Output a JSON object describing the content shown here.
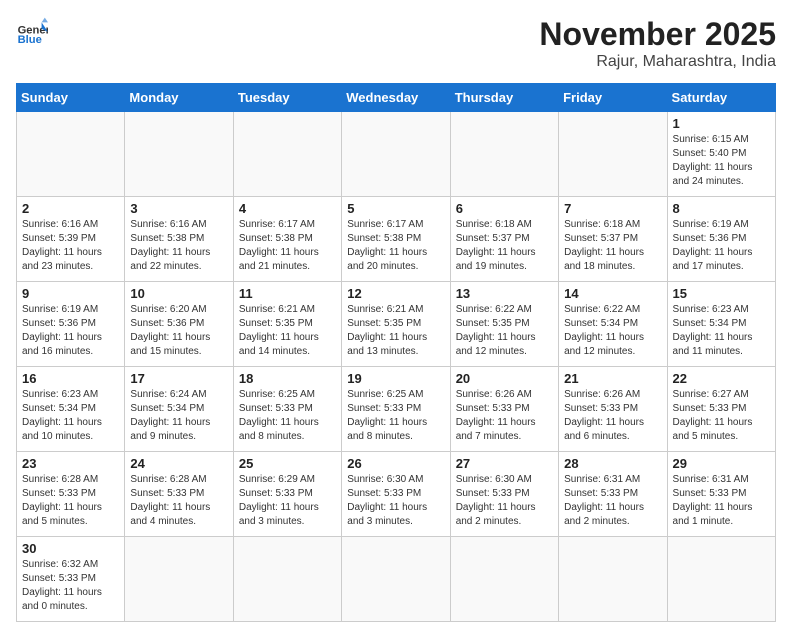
{
  "header": {
    "logo_general": "General",
    "logo_blue": "Blue",
    "month_title": "November 2025",
    "location": "Rajur, Maharashtra, India"
  },
  "weekdays": [
    "Sunday",
    "Monday",
    "Tuesday",
    "Wednesday",
    "Thursday",
    "Friday",
    "Saturday"
  ],
  "days": {
    "1": {
      "sunrise": "6:15 AM",
      "sunset": "5:40 PM",
      "daylight": "11 hours and 24 minutes."
    },
    "2": {
      "sunrise": "6:16 AM",
      "sunset": "5:39 PM",
      "daylight": "11 hours and 23 minutes."
    },
    "3": {
      "sunrise": "6:16 AM",
      "sunset": "5:38 PM",
      "daylight": "11 hours and 22 minutes."
    },
    "4": {
      "sunrise": "6:17 AM",
      "sunset": "5:38 PM",
      "daylight": "11 hours and 21 minutes."
    },
    "5": {
      "sunrise": "6:17 AM",
      "sunset": "5:38 PM",
      "daylight": "11 hours and 20 minutes."
    },
    "6": {
      "sunrise": "6:18 AM",
      "sunset": "5:37 PM",
      "daylight": "11 hours and 19 minutes."
    },
    "7": {
      "sunrise": "6:18 AM",
      "sunset": "5:37 PM",
      "daylight": "11 hours and 18 minutes."
    },
    "8": {
      "sunrise": "6:19 AM",
      "sunset": "5:36 PM",
      "daylight": "11 hours and 17 minutes."
    },
    "9": {
      "sunrise": "6:19 AM",
      "sunset": "5:36 PM",
      "daylight": "11 hours and 16 minutes."
    },
    "10": {
      "sunrise": "6:20 AM",
      "sunset": "5:36 PM",
      "daylight": "11 hours and 15 minutes."
    },
    "11": {
      "sunrise": "6:21 AM",
      "sunset": "5:35 PM",
      "daylight": "11 hours and 14 minutes."
    },
    "12": {
      "sunrise": "6:21 AM",
      "sunset": "5:35 PM",
      "daylight": "11 hours and 13 minutes."
    },
    "13": {
      "sunrise": "6:22 AM",
      "sunset": "5:35 PM",
      "daylight": "11 hours and 12 minutes."
    },
    "14": {
      "sunrise": "6:22 AM",
      "sunset": "5:34 PM",
      "daylight": "11 hours and 12 minutes."
    },
    "15": {
      "sunrise": "6:23 AM",
      "sunset": "5:34 PM",
      "daylight": "11 hours and 11 minutes."
    },
    "16": {
      "sunrise": "6:23 AM",
      "sunset": "5:34 PM",
      "daylight": "11 hours and 10 minutes."
    },
    "17": {
      "sunrise": "6:24 AM",
      "sunset": "5:34 PM",
      "daylight": "11 hours and 9 minutes."
    },
    "18": {
      "sunrise": "6:25 AM",
      "sunset": "5:33 PM",
      "daylight": "11 hours and 8 minutes."
    },
    "19": {
      "sunrise": "6:25 AM",
      "sunset": "5:33 PM",
      "daylight": "11 hours and 8 minutes."
    },
    "20": {
      "sunrise": "6:26 AM",
      "sunset": "5:33 PM",
      "daylight": "11 hours and 7 minutes."
    },
    "21": {
      "sunrise": "6:26 AM",
      "sunset": "5:33 PM",
      "daylight": "11 hours and 6 minutes."
    },
    "22": {
      "sunrise": "6:27 AM",
      "sunset": "5:33 PM",
      "daylight": "11 hours and 5 minutes."
    },
    "23": {
      "sunrise": "6:28 AM",
      "sunset": "5:33 PM",
      "daylight": "11 hours and 5 minutes."
    },
    "24": {
      "sunrise": "6:28 AM",
      "sunset": "5:33 PM",
      "daylight": "11 hours and 4 minutes."
    },
    "25": {
      "sunrise": "6:29 AM",
      "sunset": "5:33 PM",
      "daylight": "11 hours and 3 minutes."
    },
    "26": {
      "sunrise": "6:30 AM",
      "sunset": "5:33 PM",
      "daylight": "11 hours and 3 minutes."
    },
    "27": {
      "sunrise": "6:30 AM",
      "sunset": "5:33 PM",
      "daylight": "11 hours and 2 minutes."
    },
    "28": {
      "sunrise": "6:31 AM",
      "sunset": "5:33 PM",
      "daylight": "11 hours and 2 minutes."
    },
    "29": {
      "sunrise": "6:31 AM",
      "sunset": "5:33 PM",
      "daylight": "11 hours and 1 minute."
    },
    "30": {
      "sunrise": "6:32 AM",
      "sunset": "5:33 PM",
      "daylight": "11 hours and 0 minutes."
    }
  },
  "labels": {
    "sunrise": "Sunrise:",
    "sunset": "Sunset:",
    "daylight": "Daylight:"
  }
}
